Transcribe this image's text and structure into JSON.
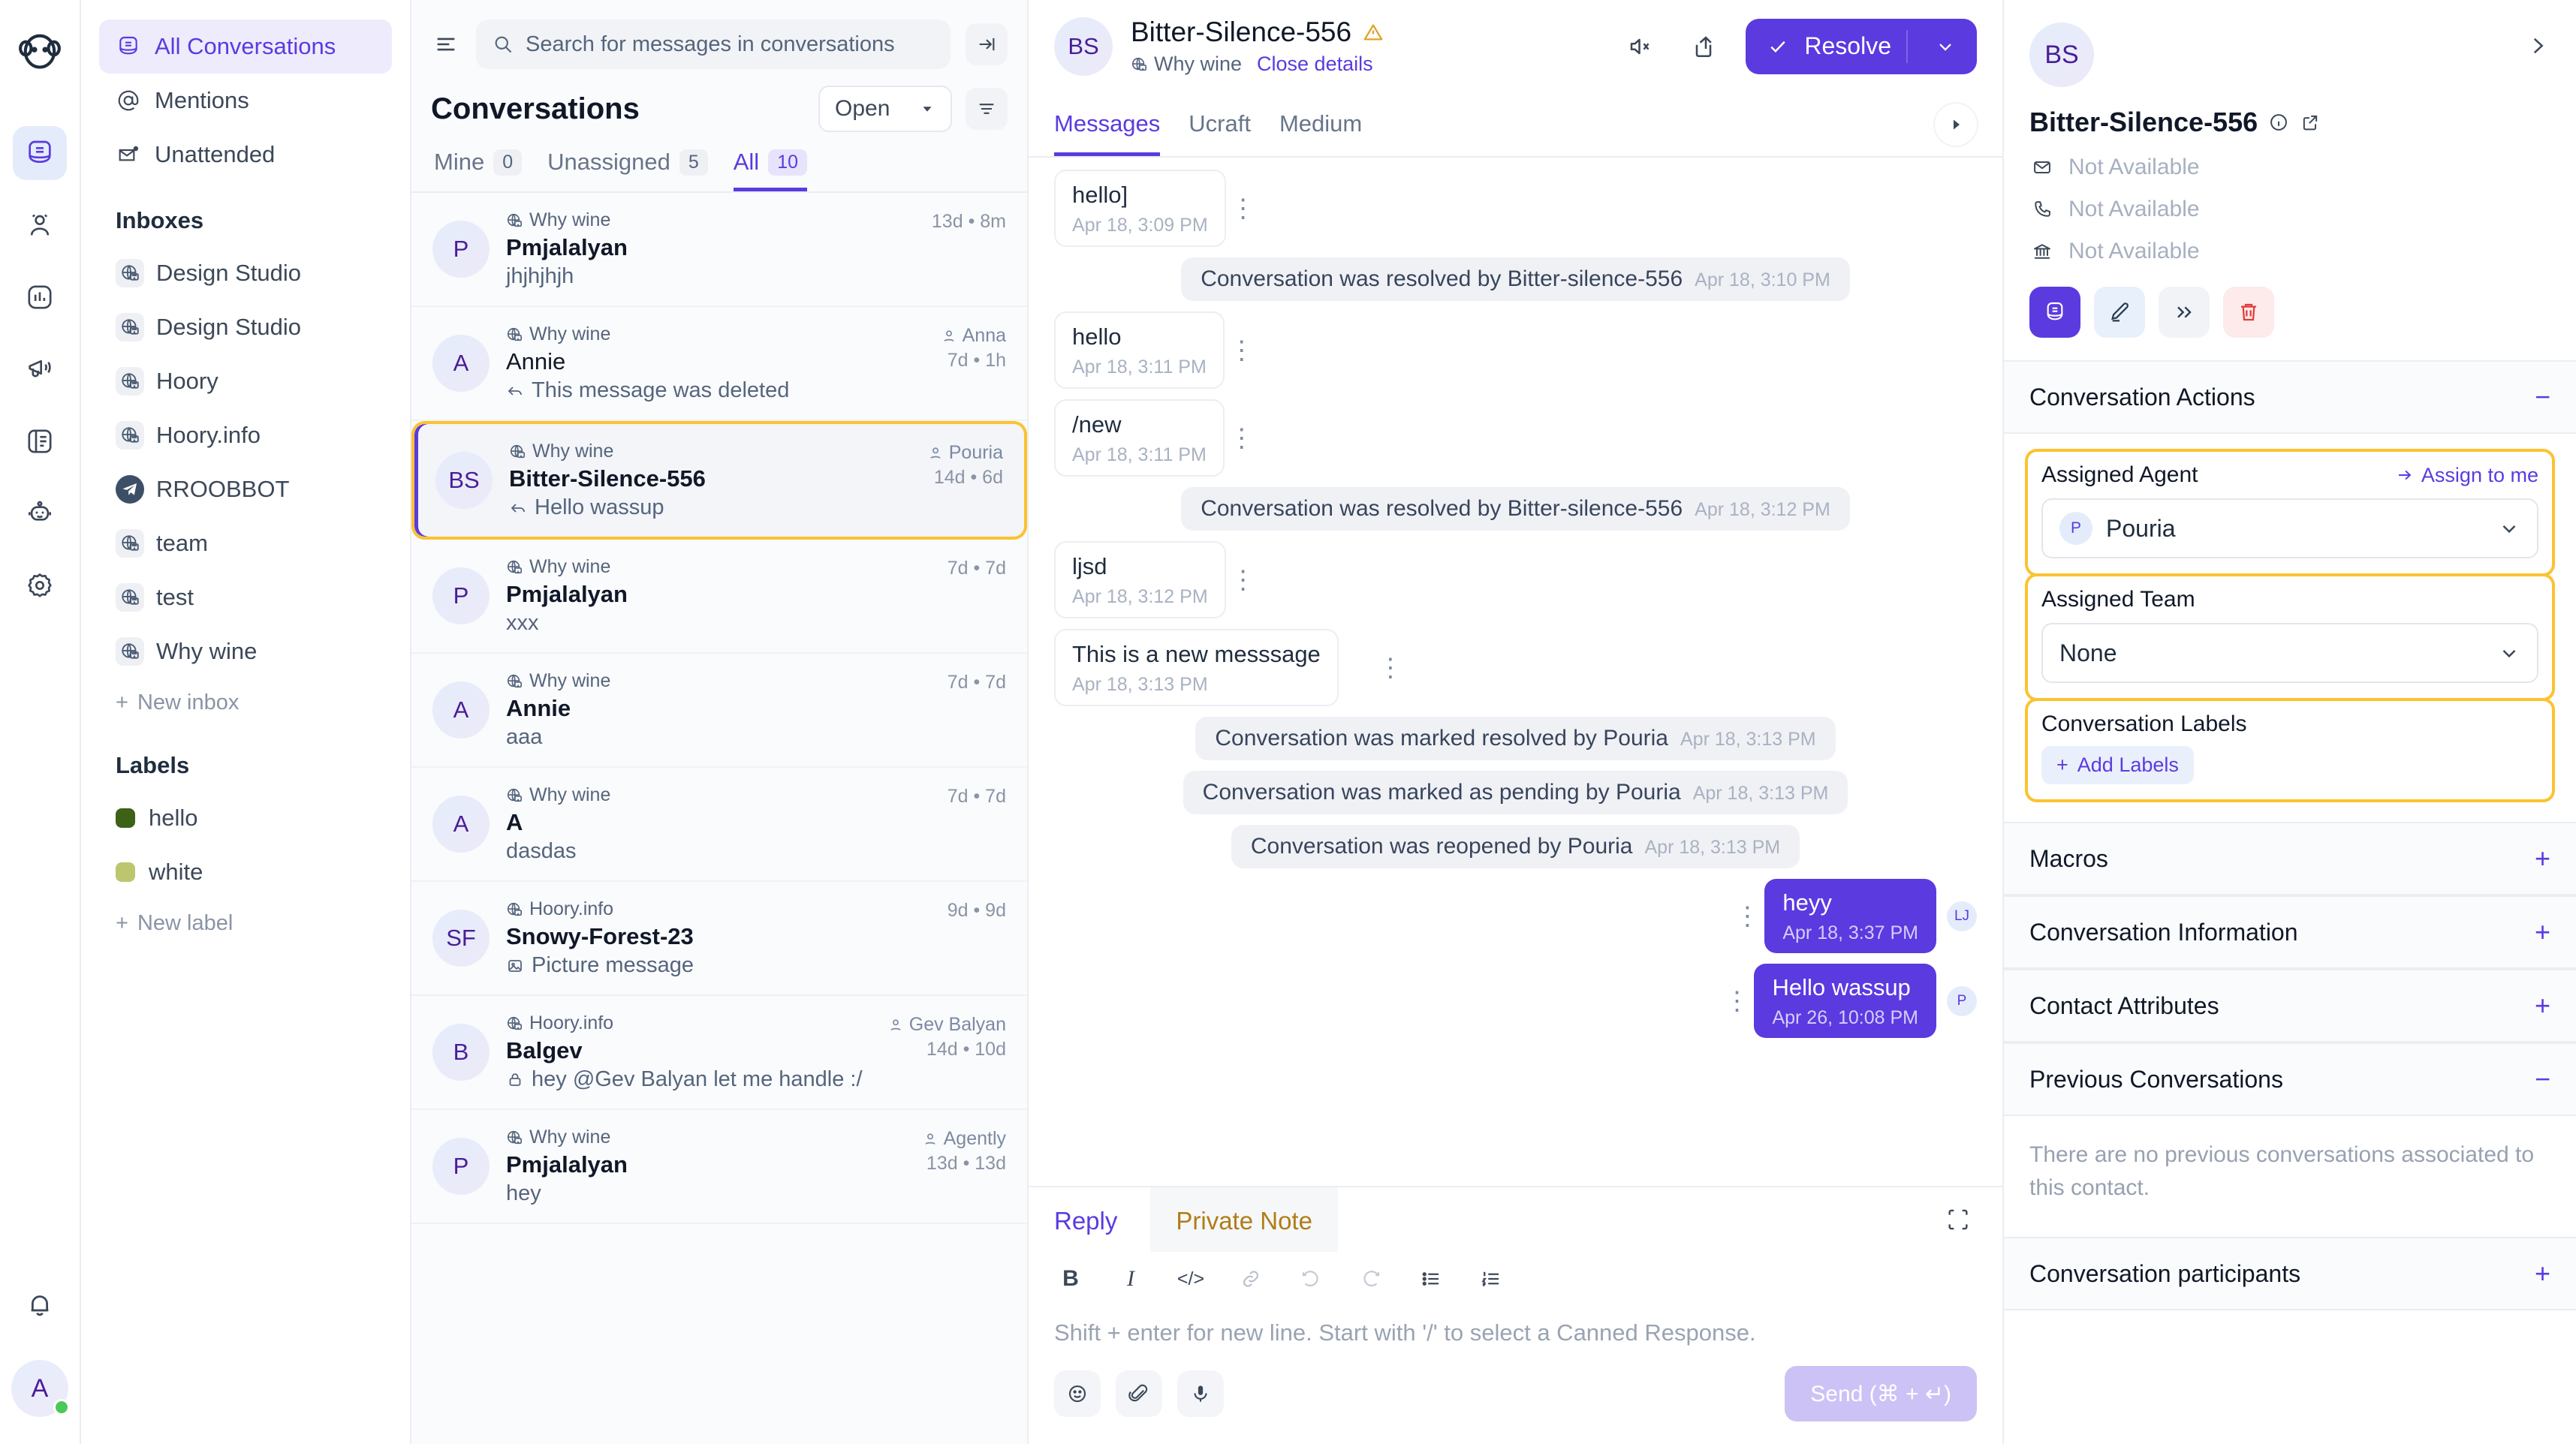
{
  "rail": {
    "logo_icon": "monkey-logo",
    "items": [
      {
        "icon": "conversations-icon",
        "name": "conversations",
        "active": true
      },
      {
        "icon": "contacts-icon",
        "name": "contacts",
        "active": false
      },
      {
        "icon": "reports-icon",
        "name": "reports",
        "active": false
      },
      {
        "icon": "campaigns-megaphone-icon",
        "name": "campaigns",
        "active": false
      },
      {
        "icon": "help-center-book-icon",
        "name": "help-center",
        "active": false
      },
      {
        "icon": "bot-icon",
        "name": "bots",
        "active": false
      },
      {
        "icon": "gear-icon",
        "name": "settings",
        "active": false
      }
    ],
    "bell_icon": "notification-bell-icon",
    "avatar_initial": "A",
    "status_color": "#4ac959"
  },
  "sidebar": {
    "primary": [
      {
        "label": "All Conversations",
        "icon": "conversations-icon",
        "active": true
      },
      {
        "label": "Mentions",
        "icon": "at-mention-icon",
        "active": false
      },
      {
        "label": "Unattended",
        "icon": "unattended-envelope-icon",
        "active": false
      }
    ],
    "inboxes_heading": "Inboxes",
    "inboxes": [
      {
        "label": "Design Studio",
        "icon": "website-globe-icon"
      },
      {
        "label": "Design Studio",
        "icon": "website-globe-icon"
      },
      {
        "label": "Hoory",
        "icon": "website-globe-icon"
      },
      {
        "label": "Hoory.info",
        "icon": "website-globe-icon"
      },
      {
        "label": "RROOBBOT",
        "icon": "telegram-icon"
      },
      {
        "label": "team",
        "icon": "website-globe-icon"
      },
      {
        "label": "test",
        "icon": "website-globe-icon"
      },
      {
        "label": "Why wine",
        "icon": "website-globe-icon"
      }
    ],
    "new_inbox_label": "New inbox",
    "labels_heading": "Labels",
    "labels": [
      {
        "label": "hello",
        "color": "#3d6117"
      },
      {
        "label": "white",
        "color": "#bcc66f"
      }
    ],
    "new_label_label": "New label"
  },
  "conversation_list": {
    "search_placeholder": "Search for messages in conversations",
    "title": "Conversations",
    "status_filter": "Open",
    "tabs": [
      {
        "label": "Mine",
        "count": "0",
        "active": false
      },
      {
        "label": "Unassigned",
        "count": "5",
        "active": false
      },
      {
        "label": "All",
        "count": "10",
        "active": true
      }
    ],
    "items": [
      {
        "initials": "P",
        "inbox": "Why wine",
        "name": "Pmjalalyan",
        "preview": "jhjhjhjh",
        "preview_icon": "",
        "assignee": "",
        "time": "13d • 8m",
        "selected": false
      },
      {
        "initials": "A",
        "inbox": "Why wine",
        "name": "Annie",
        "preview": "This message was deleted",
        "preview_icon": "reply-arrow-icon",
        "assignee": "Anna",
        "time": "7d • 1h",
        "selected": false
      },
      {
        "initials": "BS",
        "inbox": "Why wine",
        "name": "Bitter-Silence-556",
        "preview": "Hello wassup",
        "preview_icon": "reply-arrow-icon",
        "assignee": "Pouria",
        "time": "14d • 6d",
        "selected": true
      },
      {
        "initials": "P",
        "inbox": "Why wine",
        "name": "Pmjalalyan",
        "preview": "xxx",
        "preview_icon": "",
        "assignee": "",
        "time": "7d • 7d",
        "selected": false
      },
      {
        "initials": "A",
        "inbox": "Why wine",
        "name": "Annie",
        "preview": "aaa",
        "preview_icon": "",
        "assignee": "",
        "time": "7d • 7d",
        "selected": false
      },
      {
        "initials": "A",
        "inbox": "Why wine",
        "name": "A",
        "preview": "dasdas",
        "preview_icon": "",
        "assignee": "",
        "time": "7d • 7d",
        "selected": false
      },
      {
        "initials": "SF",
        "inbox": "Hoory.info",
        "name": "Snowy-Forest-23",
        "preview": "Picture message",
        "preview_icon": "image-icon",
        "assignee": "",
        "time": "9d • 9d",
        "selected": false
      },
      {
        "initials": "B",
        "inbox": "Hoory.info",
        "name": "Balgev",
        "preview": "hey @Gev Balyan let me handle :/",
        "preview_icon": "lock-icon",
        "assignee": "Gev Balyan",
        "time": "14d • 10d",
        "selected": false
      },
      {
        "initials": "P",
        "inbox": "Why wine",
        "name": "Pmjalalyan",
        "preview": "hey",
        "preview_icon": "",
        "assignee": "Agently",
        "time": "13d • 13d",
        "selected": false
      }
    ]
  },
  "chat": {
    "avatar_initials": "BS",
    "contact_name": "Bitter-Silence-556",
    "warning_icon": "warning-triangle-icon",
    "inbox": "Why wine",
    "close_details_label": "Close details",
    "mute_icon": "mute-speaker-icon",
    "share_icon": "share-icon",
    "resolve_label": "Resolve",
    "tabs": [
      {
        "label": "Messages",
        "active": true
      },
      {
        "label": "Ucraft",
        "active": false
      },
      {
        "label": "Medium",
        "active": false
      }
    ],
    "messages": [
      {
        "type": "incoming",
        "text": "hello]",
        "time": "Apr 18, 3:09 PM"
      },
      {
        "type": "system",
        "text": "Conversation was resolved by Bitter-silence-556",
        "time": "Apr 18, 3:10 PM"
      },
      {
        "type": "incoming",
        "text": "hello",
        "time": "Apr 18, 3:11 PM"
      },
      {
        "type": "incoming",
        "text": "/new",
        "time": "Apr 18, 3:11 PM"
      },
      {
        "type": "system",
        "text": "Conversation was resolved by Bitter-silence-556",
        "time": "Apr 18, 3:12 PM"
      },
      {
        "type": "incoming",
        "text": "ljsd",
        "time": "Apr 18, 3:12 PM"
      },
      {
        "type": "incoming",
        "text": "This is a new messsage",
        "time": "Apr 18, 3:13 PM"
      },
      {
        "type": "system",
        "text": "Conversation was marked resolved by Pouria",
        "time": "Apr 18, 3:13 PM"
      },
      {
        "type": "system",
        "text": "Conversation was marked as pending by Pouria",
        "time": "Apr 18, 3:13 PM"
      },
      {
        "type": "system",
        "text": "Conversation was reopened by Pouria",
        "time": "Apr 18, 3:13 PM"
      },
      {
        "type": "outgoing",
        "text": "heyy",
        "time": "Apr 18, 3:37 PM",
        "sender_initials": "LJ"
      },
      {
        "type": "outgoing",
        "text": "Hello wassup",
        "time": "Apr 26, 10:08 PM",
        "sender_initials": "P"
      }
    ]
  },
  "reply_box": {
    "tabs": [
      {
        "label": "Reply",
        "active": true
      },
      {
        "label": "Private Note",
        "active": false
      }
    ],
    "expand_icon": "expand-editor-icon",
    "toolbar": [
      {
        "icon": "bold-icon",
        "glyph": "B"
      },
      {
        "icon": "italic-icon",
        "glyph": "I"
      },
      {
        "icon": "code-icon",
        "glyph": "</>"
      },
      {
        "icon": "link-icon",
        "glyph": "⧉"
      },
      {
        "icon": "undo-icon",
        "glyph": "↶"
      },
      {
        "icon": "redo-icon",
        "glyph": "↷"
      },
      {
        "icon": "bullet-list-icon",
        "glyph": "☰"
      },
      {
        "icon": "numbered-list-icon",
        "glyph": "≡"
      }
    ],
    "placeholder": "Shift + enter for new line. Start with '/' to select a Canned Response.",
    "emoji_icon": "emoji-icon",
    "attach_icon": "attachment-paperclip-icon",
    "mic_icon": "microphone-icon",
    "send_label": "Send (⌘ + ↵)"
  },
  "right_panel": {
    "avatar_initials": "BS",
    "contact_name": "Bitter-Silence-556",
    "info_icon": "info-circle-icon",
    "external_icon": "external-link-icon",
    "collapse_icon": "chevron-right-icon",
    "attributes": [
      {
        "icon": "email-icon",
        "value": "Not Available"
      },
      {
        "icon": "phone-icon",
        "value": "Not Available"
      },
      {
        "icon": "company-bank-icon",
        "value": "Not Available"
      }
    ],
    "actions": [
      {
        "icon": "conversations-icon",
        "style": "primary"
      },
      {
        "icon": "edit-pencil-icon",
        "style": "light"
      },
      {
        "icon": "merge-contacts-icon",
        "style": "grey"
      },
      {
        "icon": "delete-trash-icon",
        "style": "danger"
      }
    ],
    "conversation_actions": {
      "title": "Conversation Actions",
      "toggle": "−",
      "assigned_agent_label": "Assigned Agent",
      "assign_to_me_label": "Assign to me",
      "assigned_agent_value": "Pouria",
      "assigned_agent_initial": "P",
      "assigned_team_label": "Assigned Team",
      "assigned_team_value": "None",
      "conversation_labels_label": "Conversation Labels",
      "add_labels_label": "Add Labels"
    },
    "sections": [
      {
        "title": "Macros",
        "toggle": "+"
      },
      {
        "title": "Conversation Information",
        "toggle": "+"
      },
      {
        "title": "Contact Attributes",
        "toggle": "+"
      },
      {
        "title": "Previous Conversations",
        "toggle": "−"
      }
    ],
    "previous_conversations_empty": "There are no previous conversations associated to this contact.",
    "participants_section": {
      "title": "Conversation participants",
      "toggle": "+"
    }
  },
  "colors": {
    "accent": "#5b3ae0",
    "highlight_border": "#fbc331",
    "note_amber": "#b07d17",
    "danger": "#e03c3c",
    "online": "#4ac959"
  }
}
